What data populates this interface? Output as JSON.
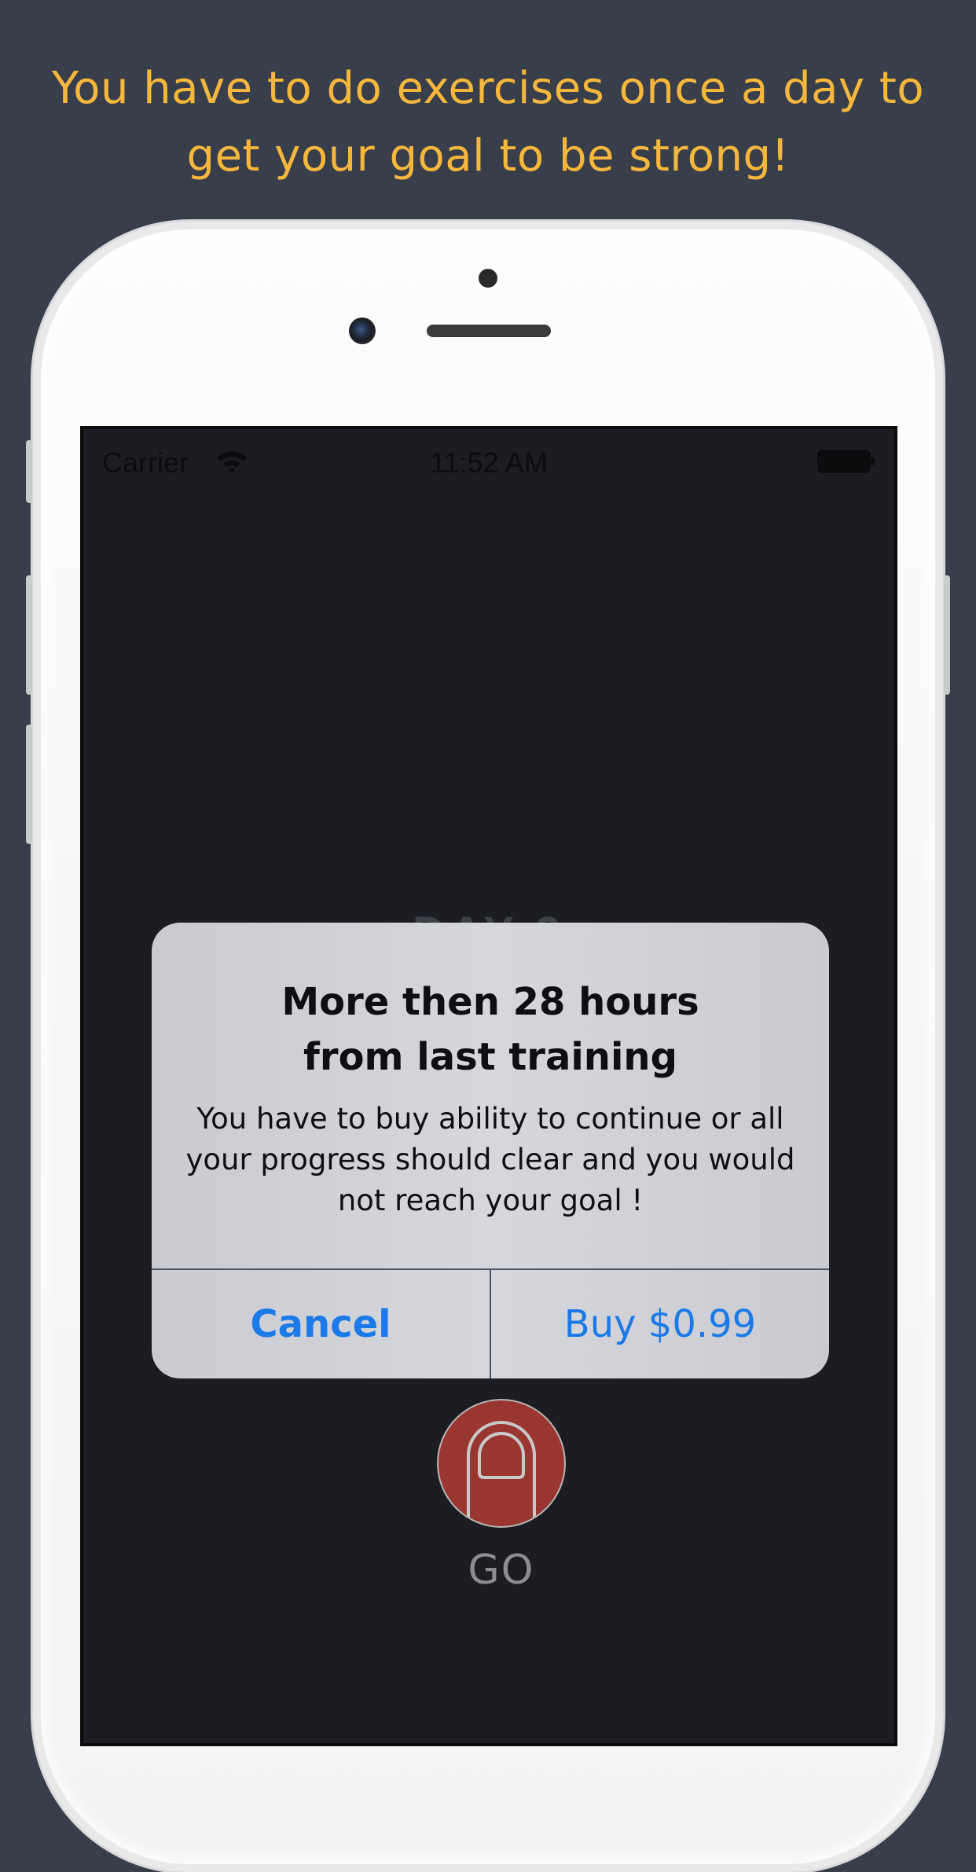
{
  "promo": {
    "headline": "You have to do exercises once  a day to\nget your goal to be strong!"
  },
  "status_bar": {
    "carrier": "Carrier",
    "time": "11:52 AM"
  },
  "screen": {
    "day_label": "DAY 2",
    "go_label": "GO"
  },
  "alert": {
    "title": "More then 28 hours\nfrom last training",
    "message": "You have to buy ability to continue or all your progress should clear and you would not reach your goal !",
    "cancel_label": "Cancel",
    "buy_label": "Buy $0.99"
  },
  "colors": {
    "background": "#383e4a",
    "promo_text": "#f6b73c",
    "alert_button": "#1b79e8",
    "go_button": "#9a3630"
  },
  "icons": [
    "wifi-icon",
    "battery-icon",
    "finger-icon"
  ]
}
